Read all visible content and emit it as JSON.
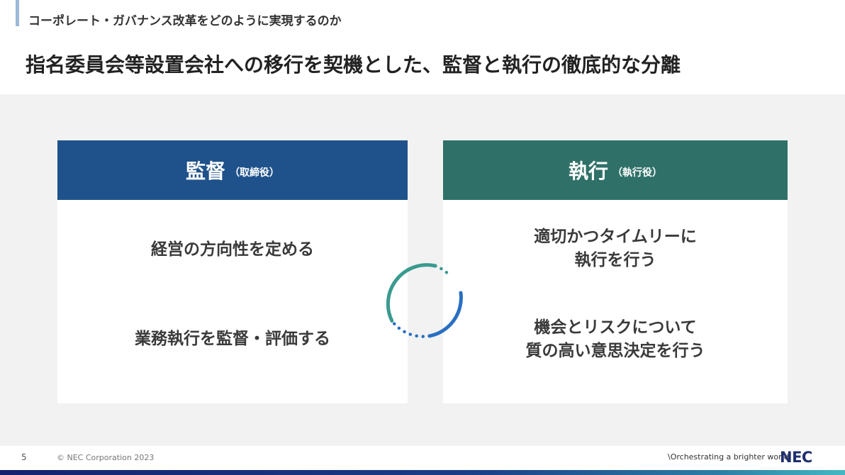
{
  "header": {
    "subtitle": "コーポレート・ガバナンス改革をどのように実現するのか",
    "title": "指名委員会等設置会社への移行を契機とした、監督と執行の徹底的な分離"
  },
  "supervision": {
    "heading": "監督",
    "subheading": "（取締役）",
    "color": "#1f528b",
    "items": [
      "経営の方向性を定める",
      "業務執行を監督・評価する"
    ]
  },
  "execution": {
    "heading": "執行",
    "subheading": "（執行役）",
    "color": "#2f7168",
    "items": [
      [
        "適切かつタイムリーに",
        "執行を行う"
      ],
      [
        "機会とリスクについて",
        "質の高い意思決定を行う"
      ]
    ]
  },
  "cycle": {
    "color_teal": "#3a9a8f",
    "color_blue": "#2a6fc2"
  },
  "footer": {
    "page_number": "5",
    "copyright": "© NEC Corporation 2023",
    "tagline": "\\Orchestrating a brighter world",
    "logo": "NEC"
  }
}
